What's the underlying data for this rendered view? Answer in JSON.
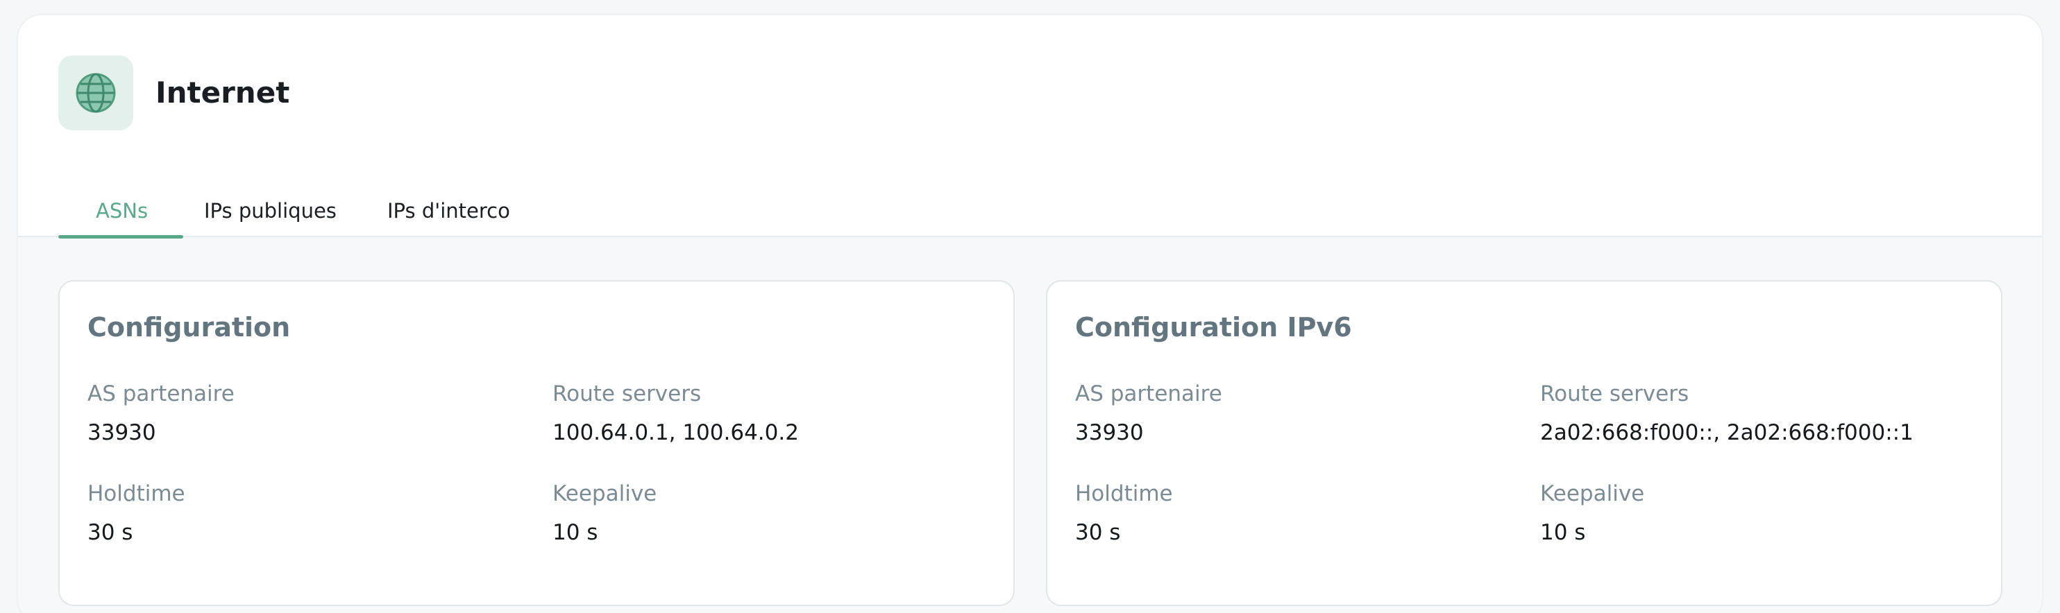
{
  "header": {
    "title": "Internet",
    "icon": "globe-icon",
    "icon_color": "#5aa88a",
    "icon_bg": "#e3f0eb"
  },
  "tabs": [
    {
      "label": "ASNs",
      "active": true
    },
    {
      "label": "IPs publiques",
      "active": false
    },
    {
      "label": "IPs d'interco",
      "active": false
    }
  ],
  "accent_color": "#5aa88a",
  "cards": [
    {
      "title": "Configuration",
      "fields": [
        {
          "label": "AS partenaire",
          "value": "33930"
        },
        {
          "label": "Route servers",
          "value": "100.64.0.1, 100.64.0.2"
        },
        {
          "label": "Holdtime",
          "value": "30 s"
        },
        {
          "label": "Keepalive",
          "value": "10 s"
        }
      ]
    },
    {
      "title": "Configuration IPv6",
      "fields": [
        {
          "label": "AS partenaire",
          "value": "33930"
        },
        {
          "label": "Route servers",
          "value": "2a02:668:f000::, 2a02:668:f000::1"
        },
        {
          "label": "Holdtime",
          "value": "30 s"
        },
        {
          "label": "Keepalive",
          "value": "10 s"
        }
      ]
    }
  ]
}
